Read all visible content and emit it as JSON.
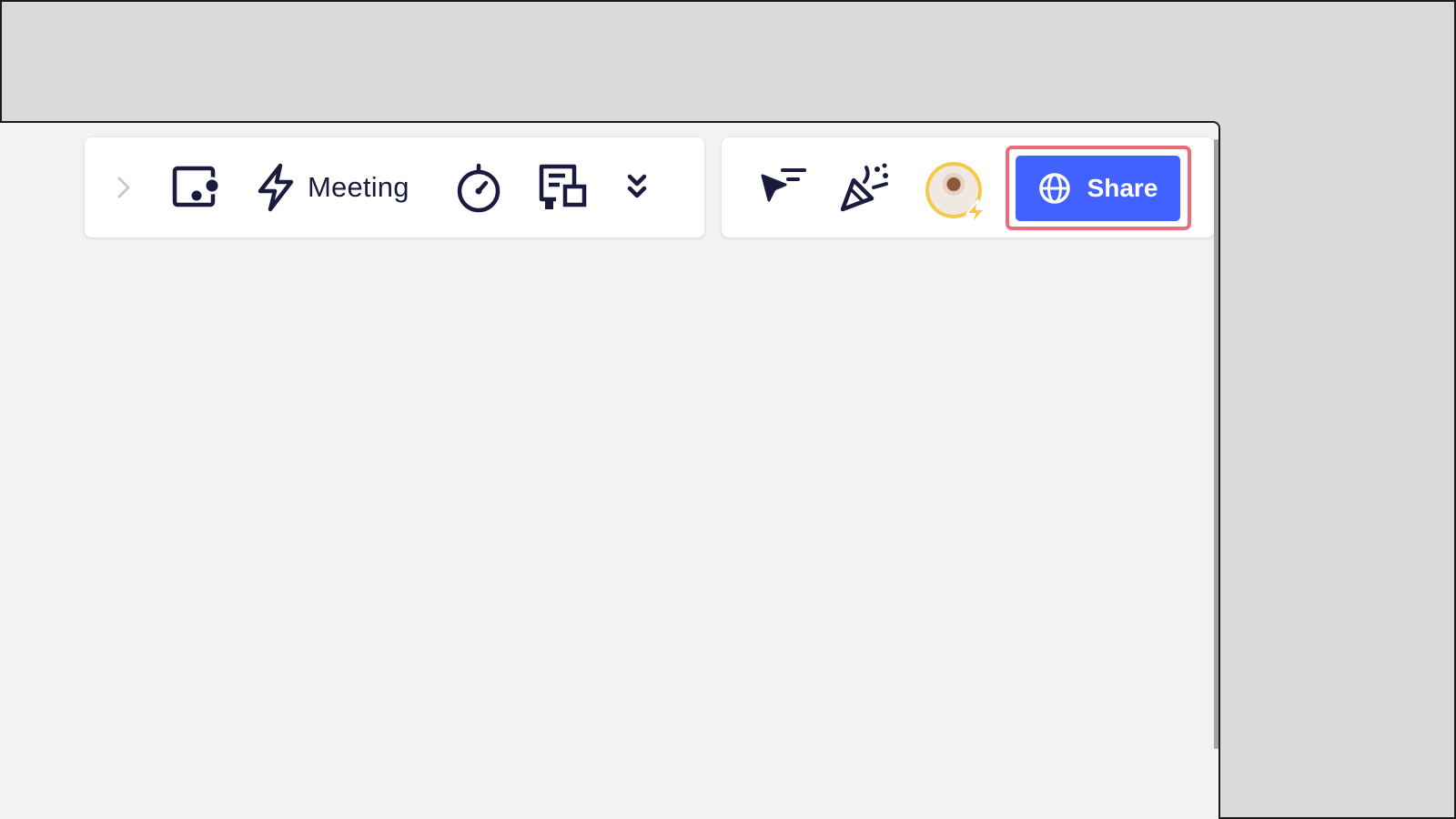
{
  "toolbar_left": {
    "expand_icon": "chevron-right-icon",
    "items": [
      {
        "name": "frame-icon"
      },
      {
        "name": "bolt-icon",
        "label": "Meeting"
      },
      {
        "name": "timer-icon"
      },
      {
        "name": "cards-icon"
      },
      {
        "name": "double-chevron-down-icon"
      }
    ]
  },
  "toolbar_right": {
    "items": [
      {
        "name": "cursor-icon"
      },
      {
        "name": "party-popper-icon"
      },
      {
        "name": "user-avatar"
      }
    ],
    "share": {
      "label": "Share",
      "icon": "globe-icon",
      "color": "#4262ff"
    },
    "highlight_color": "#ee6b7a"
  },
  "colors": {
    "icon": "#1a1b3d",
    "canvas": "#f2f2f2",
    "backdrop": "#dadada",
    "avatar_ring": "#f4c94a"
  }
}
